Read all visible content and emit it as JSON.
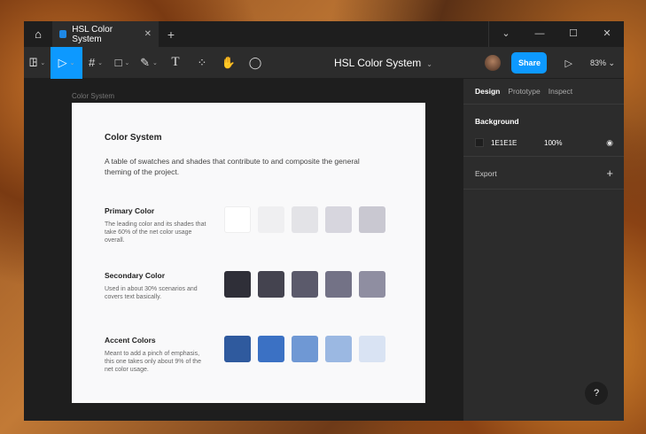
{
  "window": {
    "tab_title": "HSL Color System",
    "doc_title": "HSL Color System",
    "share": "Share",
    "zoom": "83%"
  },
  "canvas": {
    "frame_label": "Color System"
  },
  "frame": {
    "title": "Color System",
    "intro": "A table of swatches and shades that contribute to and composite the general theming of the project.",
    "sections": [
      {
        "title": "Primary Color",
        "desc": "The leading color and its shades that take 60% of the net color usage overall.",
        "swatches": [
          "#ffffff",
          "#efeff1",
          "#e3e3e7",
          "#d7d6de",
          "#c9c8d1"
        ]
      },
      {
        "title": "Secondary Color",
        "desc": "Used in about 30% scenarios and covers text basically.",
        "swatches": [
          "#2f2f38",
          "#44434f",
          "#5b5a6b",
          "#737286",
          "#8f8ea1"
        ]
      },
      {
        "title": "Accent Colors",
        "desc": "Meant to add a pinch of emphasis, this one takes only about 9% of the net color usage.",
        "swatches": [
          "#2f5a9e",
          "#3b71c4",
          "#6f98d4",
          "#9bb8e2",
          "#d9e3f3"
        ]
      }
    ]
  },
  "panel": {
    "tabs": [
      "Design",
      "Prototype",
      "Inspect"
    ],
    "background_label": "Background",
    "bg_hex": "1E1E1E",
    "bg_opacity": "100%",
    "export_label": "Export",
    "help": "?"
  }
}
